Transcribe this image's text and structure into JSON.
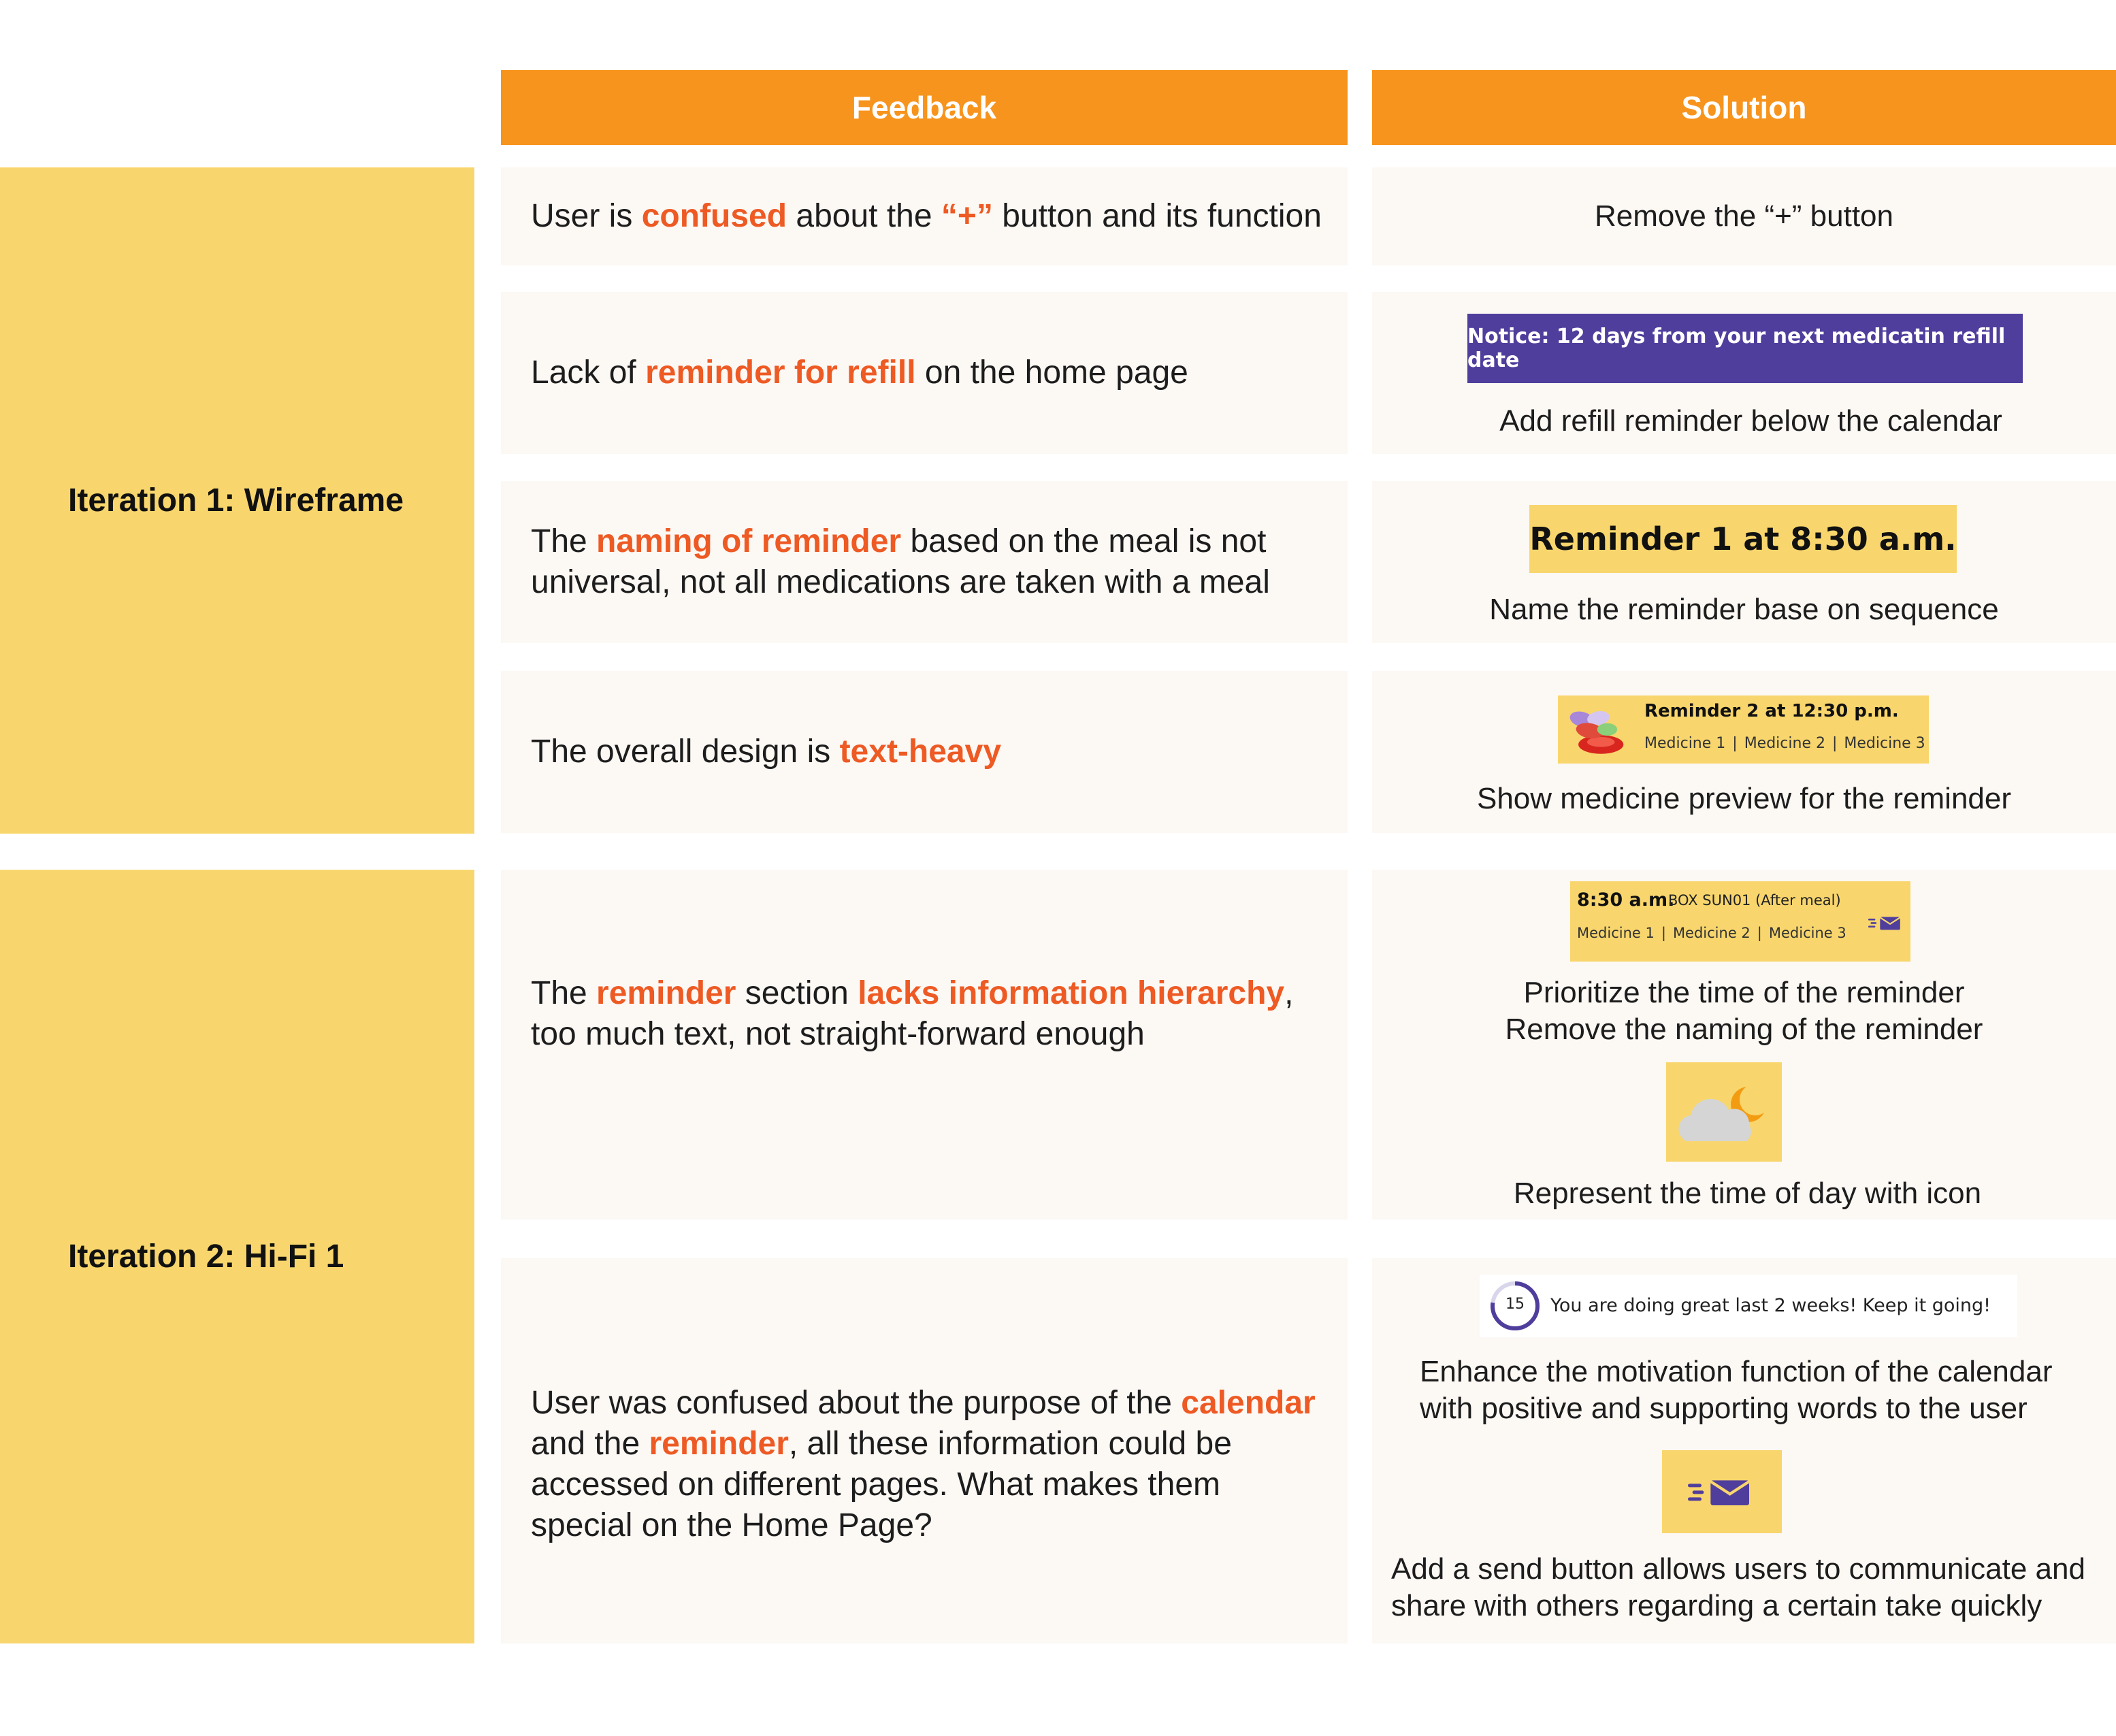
{
  "headers": {
    "feedback": "Feedback",
    "solution": "Solution"
  },
  "iterations": [
    {
      "label": "Iteration 1: Wireframe"
    },
    {
      "label": "Iteration 2: Hi-Fi 1"
    }
  ],
  "rows": [
    {
      "feedback": [
        "User is ",
        "confused",
        " about the ",
        "“+”",
        " button and its function"
      ],
      "solution": "Remove the “+” button"
    },
    {
      "feedback": [
        "Lack of ",
        "reminder for refill",
        " on the home page"
      ],
      "notice": "Notice: 12 days from your next medicatin refill date",
      "solution": "Add refill reminder below the calendar"
    },
    {
      "feedback": [
        "The ",
        "naming of reminder",
        " based on the meal is not",
        "universal, not all medications are taken with a meal"
      ],
      "reminder_chip": "Reminder 1 at 8:30 a.m.",
      "solution": "Name the reminder base on sequence"
    },
    {
      "feedback": [
        "The overall design is ",
        "text-heavy"
      ],
      "preview": {
        "title": "Reminder 2 at 12:30 p.m.",
        "medicines": [
          "Medicine 1",
          "Medicine 2",
          "Medicine 3"
        ]
      },
      "solution": "Show medicine preview for the reminder"
    },
    {
      "feedback": [
        "The ",
        "reminder",
        " section ",
        "lacks information hierarchy",
        ",",
        "too much text, not straight-forward enough"
      ],
      "card": {
        "time": "8:30 a.m.",
        "box": "BOX SUN01 (After meal)",
        "medicines": [
          "Medicine 1",
          "Medicine 2",
          "Medicine 3"
        ]
      },
      "solution_lines": [
        "Prioritize the time of the reminder",
        "Remove the naming of the reminder"
      ],
      "solution2": "Represent the time of day with icon"
    },
    {
      "feedback": [
        "User was confused about the purpose of the ",
        "calendar",
        "and the ",
        "reminder",
        ", all these information could be",
        "accessed on different pages. What makes them",
        "special on the Home Page?"
      ],
      "motivation": {
        "count": "15",
        "text": "You are doing great last 2 weeks! Keep it going!"
      },
      "solution_lines": [
        "Enhance the motivation function of the calendar",
        "with positive and supporting words to the user"
      ],
      "solution2_lines": [
        "Add a send button allows users to communicate and",
        "share with others regarding a certain take quickly"
      ]
    }
  ],
  "colors": {
    "header_orange": "#f7941d",
    "iteration_yellow": "#f8d66d",
    "highlight": "#ee5a24",
    "cell_bg": "#fcf8f4",
    "purple": "#503e9d"
  },
  "icons": [
    "pills-icon",
    "send-icon",
    "cloud-moon-icon"
  ]
}
